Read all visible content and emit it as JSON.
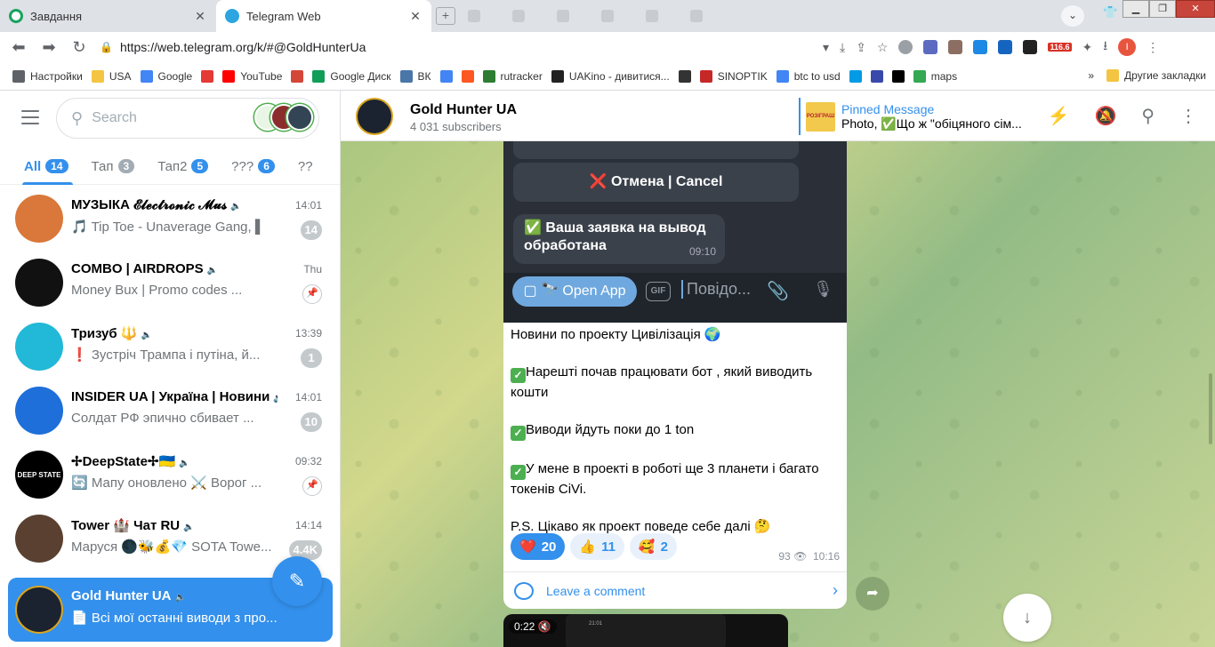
{
  "browser": {
    "tabs": [
      {
        "title": "Завдання",
        "color": "#1aa260"
      },
      {
        "title": "Telegram Web",
        "color": "#2ca5e0"
      }
    ],
    "tab_close": "✕",
    "new_tab": "+",
    "url": "https://web.telegram.org/k/#@GoldHunterUa",
    "ext_badge": "116.6",
    "profile_initial": "I",
    "bookmarks": [
      {
        "label": "Настройки",
        "color": "#5f6368"
      },
      {
        "label": "USA",
        "color": "#f4c542"
      },
      {
        "label": "Google",
        "color": "#4285f4"
      },
      {
        "label": "",
        "color": "#e53935"
      },
      {
        "label": "YouTube",
        "color": "#ff0000"
      },
      {
        "label": "",
        "color": "#d44638"
      },
      {
        "label": "Google Диск",
        "color": "#0f9d58"
      },
      {
        "label": "ВК",
        "color": "#4a76a8"
      },
      {
        "label": "",
        "color": "#4285f4"
      },
      {
        "label": "",
        "color": "#ff5722"
      },
      {
        "label": "rutracker",
        "color": "#2e7d32"
      },
      {
        "label": "UAKino - дивитися...",
        "color": "#222222"
      },
      {
        "label": "",
        "color": "#333333"
      },
      {
        "label": "SINOPTIK",
        "color": "#c62828"
      },
      {
        "label": "btc to usd",
        "color": "#4285f4"
      },
      {
        "label": "",
        "color": "#039be5"
      },
      {
        "label": "",
        "color": "#3949ab"
      },
      {
        "label": "",
        "color": "#000000"
      },
      {
        "label": "maps",
        "color": "#34a853"
      }
    ],
    "bookmarks_more": "»",
    "other_bookmarks": "Другие закладки"
  },
  "sidebar": {
    "search_placeholder": "Search",
    "folders": [
      {
        "label": "All",
        "count": "14"
      },
      {
        "label": "Тап",
        "count": "3"
      },
      {
        "label": "Тап2",
        "count": "5"
      },
      {
        "label": "???",
        "count": "6"
      },
      {
        "label": "??",
        "count": ""
      }
    ],
    "chats": [
      {
        "name": "МУЗЫКА 𝓔𝓵𝓮𝓬𝓽𝓻𝓸𝓷𝓲𝓬 𝓜𝓾𝓼",
        "time": "14:01",
        "preview": "🎵 Tip Toe - Unaverage Gang, ▌",
        "count": "14",
        "avatar_color": "#d9783a",
        "avatar_label": ""
      },
      {
        "name": "COMBO | AIRDROPS",
        "time": "Thu",
        "preview": "Money Bux | Promo codes ...",
        "count": "",
        "pinned": true,
        "avatar_color": "#111111",
        "avatar_label": ""
      },
      {
        "name": "Тризуб 🔱",
        "time": "13:39",
        "preview": "❗ Зустріч Трампа і путіна, й...",
        "count": "1",
        "avatar_color": "#22b8d8",
        "avatar_label": ""
      },
      {
        "name": "INSIDER UA | Україна | Новини",
        "time": "14:01",
        "preview": "Солдат РФ эпично сбивает ...",
        "count": "10",
        "avatar_color": "#1e6fd9",
        "avatar_label": ""
      },
      {
        "name": "✢DeepState✢🇺🇦",
        "time": "09:32",
        "preview": "🔄 Мапу оновлено ⚔️ Ворог ...",
        "count": "",
        "pinned": true,
        "avatar_color": "#000000",
        "avatar_label": "DEEP STATE"
      },
      {
        "name": "Tower 🏰 Чат RU",
        "time": "14:14",
        "preview": "Маруся 🌑🐝💰💎 SOTA Towe...",
        "count": "4.4K",
        "avatar_color": "#5a4030",
        "avatar_label": ""
      }
    ],
    "selected_chat": {
      "name": "Gold Hunter UA",
      "preview": "📄 Всі мої останні виводи з про...",
      "avatar_color": "#1c2330"
    }
  },
  "channel": {
    "title": "Gold Hunter UA",
    "subscribers": "4 031 subscribers",
    "pinned_label": "Pinned Message",
    "pinned_text": "Photo, ✅Що ж \"обіцяного сім...",
    "pinned_thumb_text": "РОЗІГРАШ ПРИЗІВ"
  },
  "message": {
    "screenshot": {
      "cancel_button": "❌ Отмена | Cancel",
      "bubble_text": "✅ Ваша заявка на вывод обработана",
      "bubble_time": "09:10",
      "open_app": "Open App",
      "gif": "GIF",
      "composer_placeholder": "Повідо..."
    },
    "paragraphs": [
      {
        "check": false,
        "text": "Новини по проекту Цивілізація 🌍"
      },
      {
        "check": true,
        "text": "Нарешті почав працювати бот , який виводить кошти"
      },
      {
        "check": true,
        "text": "Виводи йдуть поки до 1 ton"
      },
      {
        "check": true,
        "text": "У мене в проекті в роботі ще 3 планети і багато токенів CiVi."
      },
      {
        "check": false,
        "text": "P.S. Цікаво як проект поведе себе далі 🤔"
      }
    ],
    "reactions": [
      {
        "emoji": "❤️",
        "count": "20",
        "mine": true
      },
      {
        "emoji": "👍",
        "count": "11",
        "mine": false
      },
      {
        "emoji": "🥰",
        "count": "2",
        "mine": false
      }
    ],
    "views": "93",
    "time": "10:16",
    "comment_label": "Leave a comment"
  },
  "video": {
    "duration": "0:22",
    "preview_time": "21:01"
  }
}
